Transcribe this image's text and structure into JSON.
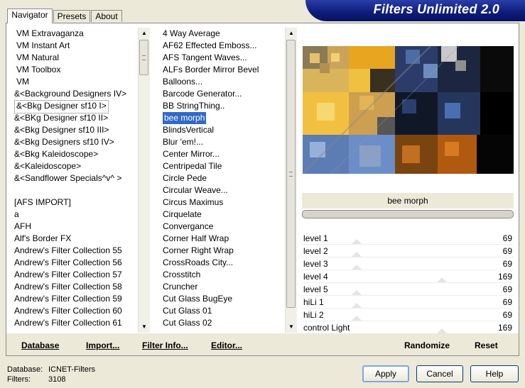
{
  "window": {
    "brand": "Filters Unlimited 2.0"
  },
  "tabs": [
    {
      "label": "Navigator",
      "active": true
    },
    {
      "label": "Presets",
      "active": false
    },
    {
      "label": "About",
      "active": false
    }
  ],
  "categories": {
    "items": [
      "VM Extravaganza",
      "VM Instant Art",
      "VM Natural",
      "VM Toolbox",
      "VM",
      "&<Background Designers IV>",
      "&<Bkg Designer sf10 I>",
      "&<BKg Designer sf10 II>",
      "&<Bkg Designer sf10 III>",
      "&<Bkg Designers sf10 IV>",
      "&<Bkg Kaleidoscope>",
      "&<Kaleidoscope>",
      "&<Sandflower Specials^v^ >",
      "",
      "[AFS IMPORT]",
      "a",
      "AFH",
      "Alf's Border FX",
      "Andrew's Filter Collection 55",
      "Andrew's Filter Collection 56",
      "Andrew's Filter Collection 57",
      "Andrew's Filter Collection 58",
      "Andrew's Filter Collection 59",
      "Andrew's Filter Collection 60",
      "Andrew's Filter Collection 61"
    ],
    "selected_index": 6
  },
  "filters": {
    "items": [
      "4 Way Average",
      "AF62 Effected Emboss...",
      "AFS Tangent Waves...",
      "ALFs Border Mirror Bevel",
      "Balloons...",
      "Barcode Generator...",
      "BB StringThing..",
      "bee morph",
      "BlindsVertical",
      "Blur 'em!...",
      "Center Mirror...",
      "Centripedal Tile",
      "Circle Pede",
      "Circular Weave...",
      "Circus Maximus",
      "Cirquelate",
      "Convergance",
      "Corner Half Wrap",
      "Corner Right Wrap",
      "CrossRoads City...",
      "Crosstitch",
      "Cruncher",
      "Cut Glass  BugEye",
      "Cut Glass 01",
      "Cut Glass 02"
    ],
    "selected_index": 7
  },
  "preview": {
    "filter_name": "bee morph"
  },
  "sliders": [
    {
      "label": "level 1",
      "value": 69
    },
    {
      "label": "level 2",
      "value": 69
    },
    {
      "label": "level 3",
      "value": 69
    },
    {
      "label": "level 4",
      "value": 169
    },
    {
      "label": "level 5",
      "value": 69
    },
    {
      "label": "hiLi 1",
      "value": 69
    },
    {
      "label": "hiLi 2",
      "value": 69
    },
    {
      "label": "control Light",
      "value": 169
    }
  ],
  "toolbar": {
    "database": "Database",
    "import": "Import...",
    "filter_info": "Filter Info...",
    "editor": "Editor...",
    "randomize": "Randomize",
    "reset": "Reset"
  },
  "status": {
    "database_label": "Database:",
    "database_value": "ICNET-Filters",
    "filters_label": "Filters:",
    "filters_value": "3108"
  },
  "buttons": {
    "apply": "Apply",
    "cancel": "Cancel",
    "help": "Help"
  }
}
